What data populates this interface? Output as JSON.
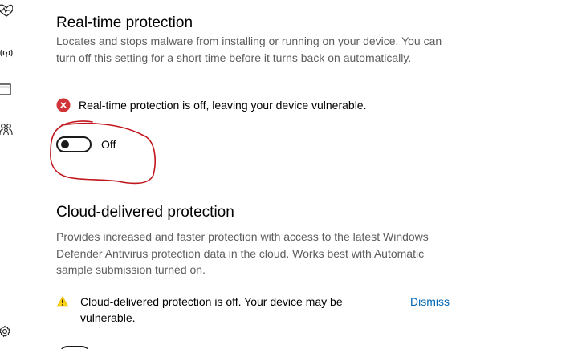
{
  "realtime": {
    "title": "Real-time protection",
    "description": "Locates and stops malware from installing or running on your device. You can turn off this setting for a short time before it turns back on automatically.",
    "status_text": "Real-time protection is off, leaving your device vulnerable.",
    "status_icon": "error-circle-icon",
    "status_color": "#d13438",
    "toggle_state_label": "Off",
    "toggle_on": false
  },
  "cloud": {
    "title": "Cloud-delivered protection",
    "description": "Provides increased and faster protection with access to the latest Windows Defender Antivirus protection data in the cloud. Works best with Automatic sample submission turned on.",
    "warning_text": "Cloud-delivered protection is off. Your device may be vulnerable.",
    "warning_icon": "warning-triangle-icon",
    "warning_color": "#fcd116",
    "dismiss_label": "Dismiss",
    "link_color": "#0066b4"
  },
  "sidebar": {
    "icons": [
      "heartbeat-icon",
      "wifi-signal-icon",
      "app-window-icon",
      "family-icon",
      "settings-gear-icon"
    ]
  },
  "annotation": {
    "type": "hand-drawn-circle",
    "color": "#c0161d"
  }
}
